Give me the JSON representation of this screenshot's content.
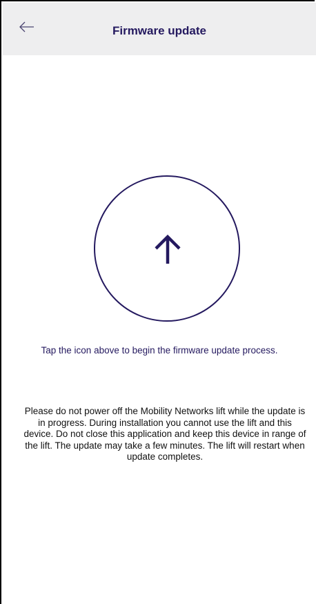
{
  "header": {
    "title": "Firmware update",
    "back_icon": "arrow-left-icon"
  },
  "upload": {
    "icon": "arrow-up-icon"
  },
  "instruction_text": "Tap the icon above to begin the firmware update process.",
  "warning_text": "Please do not power off the Mobility Networks lift while the update is in progress. During installation you cannot use the lift and this device. Do not close this application and keep this device in range of the lift. The update may take a few minutes. The lift will restart when update completes.",
  "colors": {
    "accent": "#24195f",
    "header_bg": "#eeeeef",
    "text": "#111111"
  }
}
